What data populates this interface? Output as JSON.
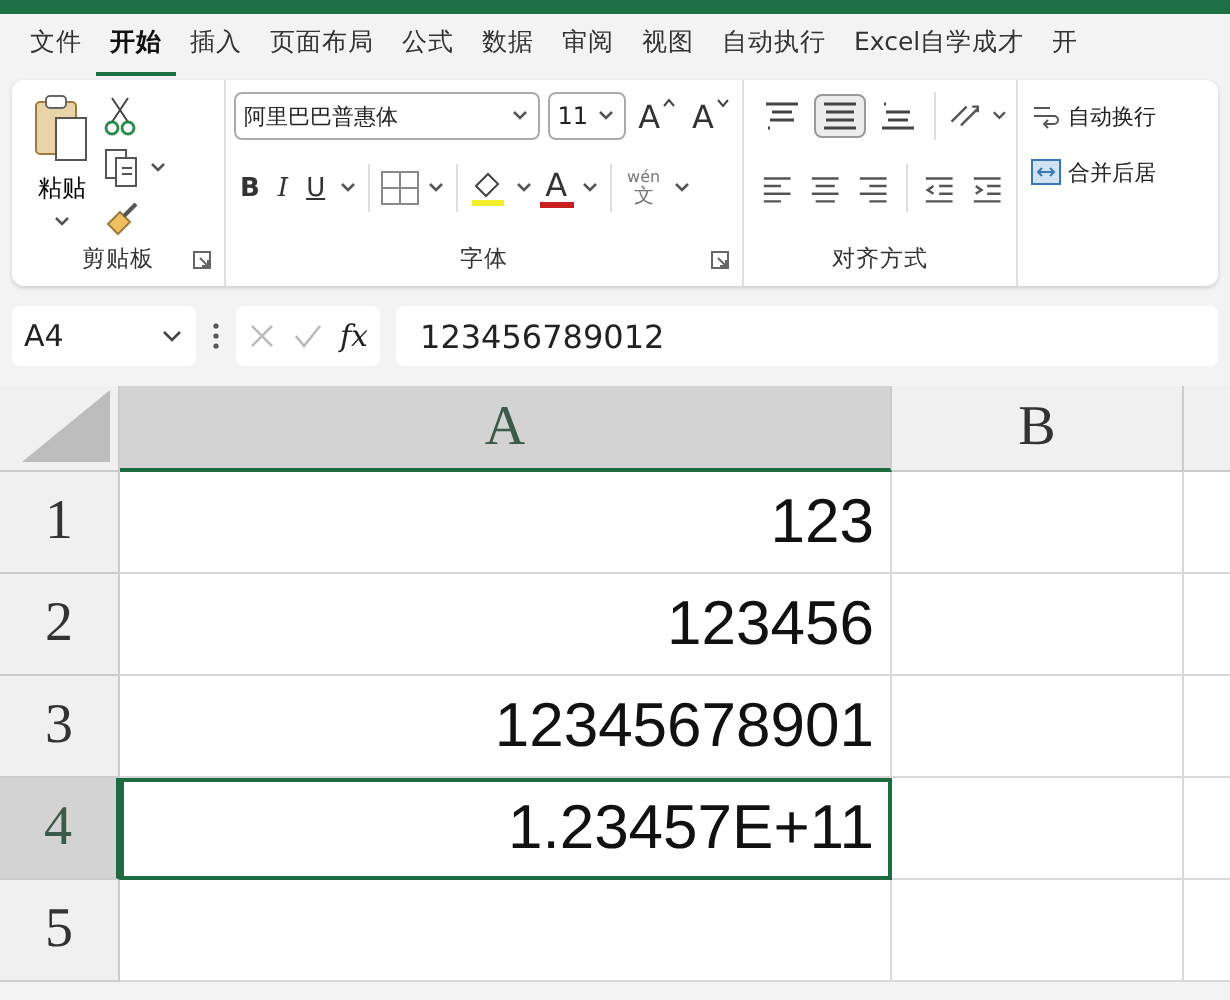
{
  "tabs": [
    {
      "label": "文件",
      "selected": false
    },
    {
      "label": "开始",
      "selected": true
    },
    {
      "label": "插入",
      "selected": false
    },
    {
      "label": "页面布局",
      "selected": false
    },
    {
      "label": "公式",
      "selected": false
    },
    {
      "label": "数据",
      "selected": false
    },
    {
      "label": "审阅",
      "selected": false
    },
    {
      "label": "视图",
      "selected": false
    },
    {
      "label": "自动执行",
      "selected": false
    },
    {
      "label": "Excel自学成才",
      "selected": false
    },
    {
      "label": "开",
      "selected": false
    }
  ],
  "ribbon": {
    "clipboard": {
      "paste_label": "粘贴",
      "group_label": "剪贴板"
    },
    "font": {
      "font_name": "阿里巴巴普惠体",
      "font_size": "11",
      "grow_label": "A",
      "shrink_label": "A",
      "bold_label": "B",
      "italic_label": "I",
      "underline_label": "U",
      "font_color_label": "A",
      "phonetic_top": "wén",
      "phonetic_bottom": "文",
      "group_label": "字体"
    },
    "alignment": {
      "vertical": [
        {
          "kind": "top",
          "selected": false
        },
        {
          "kind": "middle",
          "selected": true
        },
        {
          "kind": "bottom",
          "selected": false
        }
      ],
      "group_label": "对齐方式"
    },
    "wrap_label": "自动换行",
    "merge_label": "合并后居"
  },
  "formula_bar": {
    "name_box": "A4",
    "fx_label": "fx",
    "formula": "123456789012"
  },
  "grid": {
    "columns": [
      {
        "label": "A",
        "selected": true
      },
      {
        "label": "B",
        "selected": false
      }
    ],
    "rows": [
      {
        "header": "1",
        "selected": false,
        "value": "123",
        "active": false
      },
      {
        "header": "2",
        "selected": false,
        "value": "123456",
        "active": false
      },
      {
        "header": "3",
        "selected": false,
        "value": "12345678901",
        "active": false
      },
      {
        "header": "4",
        "selected": true,
        "value": "1.23457E+11",
        "active": true
      },
      {
        "header": "5",
        "selected": false,
        "active": false
      }
    ]
  }
}
